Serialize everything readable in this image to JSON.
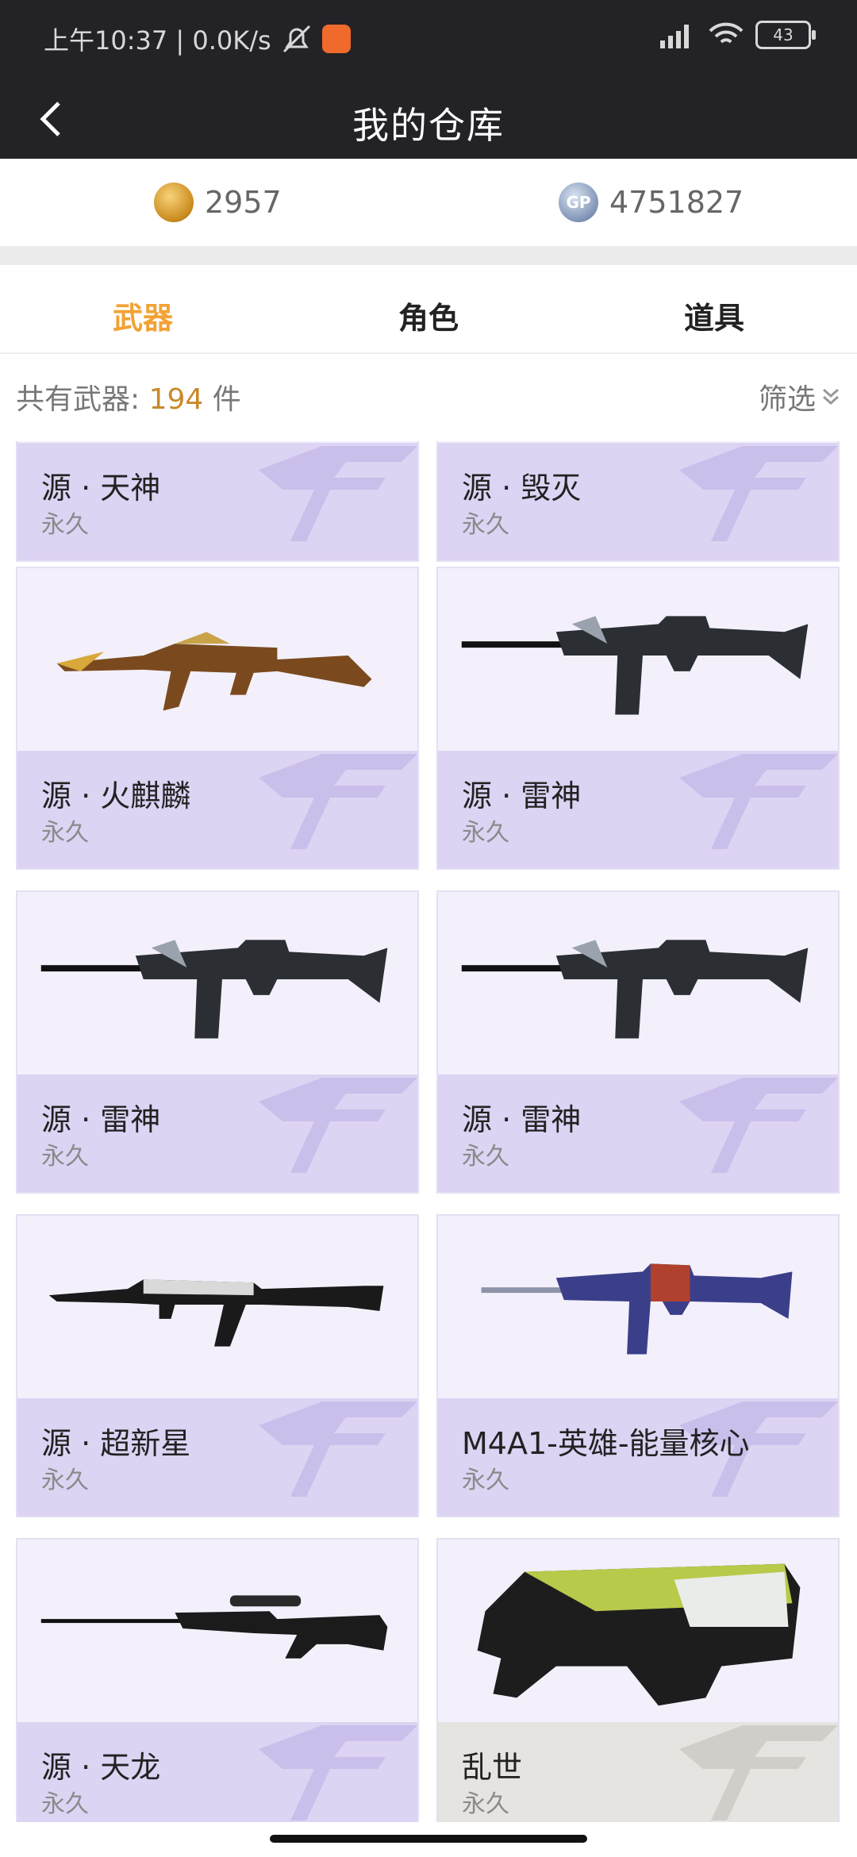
{
  "status": {
    "time": "上午10:37 | 0.0K/s",
    "battery": "43"
  },
  "header": {
    "title": "我的仓库"
  },
  "currency": {
    "cf_points": "2957",
    "gp": "4751827",
    "gp_label": "GP"
  },
  "tabs": [
    "武器",
    "角色",
    "道具"
  ],
  "summary": {
    "label": "共有武器:",
    "count": "194",
    "unit": "件",
    "filter": "筛选"
  },
  "items": [
    {
      "name": "源 · 天神",
      "duration": "永久"
    },
    {
      "name": "源 · 毁灭",
      "duration": "永久"
    },
    {
      "name": "源 · 火麒麟",
      "duration": "永久"
    },
    {
      "name": "源 · 雷神",
      "duration": "永久"
    },
    {
      "name": "源 · 雷神",
      "duration": "永久"
    },
    {
      "name": "源 · 雷神",
      "duration": "永久"
    },
    {
      "name": "源 · 超新星",
      "duration": "永久"
    },
    {
      "name": "M4A1-英雄-能量核心",
      "duration": "永久"
    },
    {
      "name": "源 · 天龙",
      "duration": "永久"
    },
    {
      "name": "乱世",
      "duration": "永久"
    }
  ],
  "colors": {
    "accent": "#f2a234",
    "card_bg": "#f3f0fb",
    "card_footer": "#ddd3f3",
    "header_bg": "#232327"
  }
}
